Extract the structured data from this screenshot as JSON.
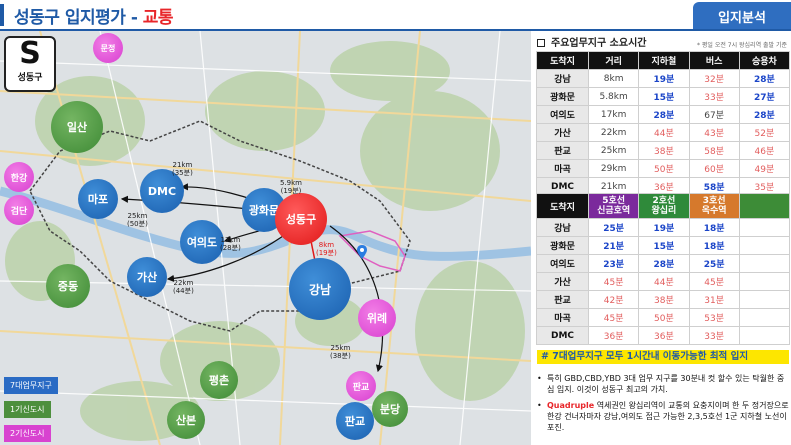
{
  "header": {
    "title_main": "성동구 입지평가 - ",
    "title_accent": "교통",
    "badge": "입지분석"
  },
  "logo": {
    "letter": "S",
    "name": "성동구"
  },
  "map": {
    "places": {
      "seongdong": "성동구",
      "gangnam": "강남",
      "gwanghwamun": "광화문",
      "yeouido": "여의도",
      "gasan": "가산",
      "mapo": "마포",
      "dmc": "DMC",
      "ilsan": "일산",
      "jungdong": "중동",
      "pyeongchon": "평촌",
      "sanbon": "산본",
      "pangyo_blue": "판교",
      "pangyo_pink": "판교",
      "bundang": "분당",
      "munjeong": "문정",
      "hangang": "한강",
      "geomdan": "검단",
      "wirye": "위례"
    },
    "routes": {
      "gwanghwamun": [
        "5.9km",
        "(19분)"
      ],
      "dmc": [
        "21km",
        "(35분)"
      ],
      "mapo": [
        "25km",
        "(50분)"
      ],
      "yeouido": [
        "17km",
        "(28분)"
      ],
      "gasan": [
        "22km",
        "(44분)"
      ],
      "gangnam": [
        "8km",
        "(19분)"
      ],
      "pangyo": [
        "25km",
        "(38분)"
      ]
    },
    "legend": {
      "major": "7대업무지구",
      "first": "1기신도시",
      "second": "2기신도시"
    }
  },
  "panel": {
    "heading": "주요업무지구 소요시간",
    "note": "* 평일 오전 7시 왕십리역 출발 기준",
    "table1": {
      "headers": [
        "도착지",
        "거리",
        "지하철",
        "버스",
        "승용차"
      ],
      "rows": [
        [
          "강남",
          "8km",
          "19분",
          "32분",
          "28분"
        ],
        [
          "광화문",
          "5.8km",
          "15분",
          "33분",
          "27분"
        ],
        [
          "여의도",
          "17km",
          "28분",
          "67분",
          "28분"
        ],
        [
          "가산",
          "22km",
          "44분",
          "43분",
          "52분"
        ],
        [
          "판교",
          "25km",
          "38분",
          "58분",
          "46분"
        ],
        [
          "마곡",
          "29km",
          "50분",
          "60분",
          "49분"
        ],
        [
          "DMC",
          "21km",
          "36분",
          "58분",
          "35분"
        ]
      ]
    },
    "table2": {
      "headers": {
        "dest": "도착지",
        "line5_top": "5호선",
        "line5_bot": "신금호역",
        "line2_top": "2호선",
        "line2_bot": "왕십리",
        "line3_top": "3호선",
        "line3_bot": "옥수역"
      },
      "rows": [
        [
          "강남",
          "25분",
          "19분",
          "18분"
        ],
        [
          "광화문",
          "21분",
          "15분",
          "18분"
        ],
        [
          "여의도",
          "23분",
          "28분",
          "25분"
        ],
        [
          "가산",
          "45분",
          "44분",
          "45분"
        ],
        [
          "판교",
          "42분",
          "38분",
          "31분"
        ],
        [
          "마곡",
          "45분",
          "50분",
          "53분"
        ],
        [
          "DMC",
          "36분",
          "36분",
          "33분"
        ]
      ]
    },
    "highlight": "# 7대업무지구 모두 1시간내 이동가능한 최적 입지",
    "bullet1": "특히 GBD,CBD,YBD 3대 업무 지구를 30분내 컷 할수 있는 탁월한 중심 입지. 이것이 성동구 최고의 가치.",
    "bullet2_a": "Quadruple",
    "bullet2_b": " 역세권인 왕십리역이 교통의 요충지이며 한 두 정거장으로 한강 건너자마자 강남,여의도 접근 가능한 2,3,5호선 1군 지하철 노선이 포진."
  },
  "colors": {
    "brand": "#1f5aa6",
    "accent": "#e8262a",
    "subway_fast": "#1b45c8",
    "slow": "#e25e5e",
    "highlight": "#fde600"
  }
}
